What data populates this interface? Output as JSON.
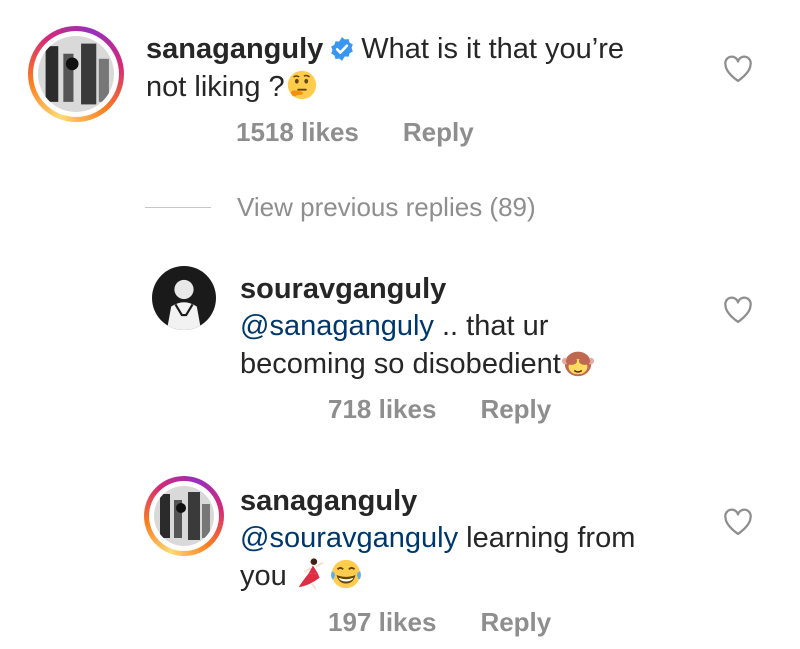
{
  "comments": [
    {
      "username": "sanaganguly",
      "verified": true,
      "text_before": "What is it that you’re not liking ?",
      "emoji": "thinking-face",
      "likes": "1518 likes",
      "reply": "Reply"
    },
    {
      "username": "souravganguly",
      "mention": "@sanaganguly",
      "text_line1": " .. that ur",
      "text_line2": "becoming so disobedient",
      "emoji": "see-no-evil-monkey",
      "likes": "718 likes",
      "reply": "Reply"
    },
    {
      "username": "sanaganguly",
      "mention": "@souravganguly",
      "text_line1": " learning from",
      "text_line2": "you",
      "emojis": [
        "dancer",
        "face-with-tears-of-joy"
      ],
      "likes": "197 likes",
      "reply": "Reply"
    }
  ],
  "view_previous": "View previous replies (89)",
  "colors": {
    "text": "#262626",
    "muted": "#8e8e8e",
    "mention": "#00376b",
    "verified": "#3897f0"
  }
}
